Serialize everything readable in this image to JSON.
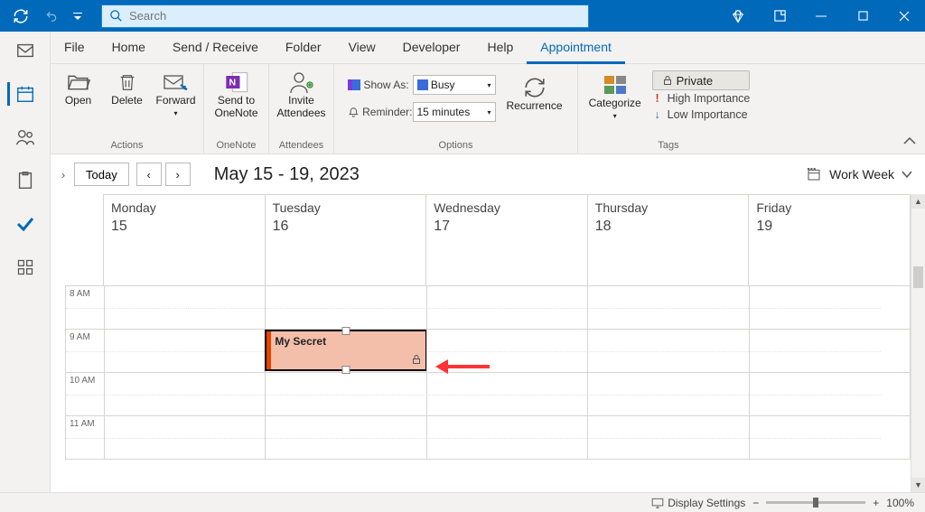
{
  "titlebar": {
    "search_placeholder": "Search"
  },
  "tabs": {
    "file": "File",
    "home": "Home",
    "sendreceive": "Send / Receive",
    "folder": "Folder",
    "view": "View",
    "developer": "Developer",
    "help": "Help",
    "appointment": "Appointment"
  },
  "ribbon": {
    "open": "Open",
    "delete": "Delete",
    "forward": "Forward",
    "actions_label": "Actions",
    "sendto": "Send to OneNote",
    "onenote_label": "OneNote",
    "invite": "Invite Attendees",
    "attendees_label": "Attendees",
    "showas": "Show As:",
    "showas_val": "Busy",
    "reminder": "Reminder:",
    "reminder_val": "15 minutes",
    "recurrence": "Recurrence",
    "options_label": "Options",
    "categorize": "Categorize",
    "private": "Private",
    "high": "High Importance",
    "low": "Low Importance",
    "tags_label": "Tags"
  },
  "calheader": {
    "today": "Today",
    "range": "May 15 - 19, 2023",
    "viewmode": "Work Week"
  },
  "days": [
    {
      "name": "Monday",
      "num": "15"
    },
    {
      "name": "Tuesday",
      "num": "16"
    },
    {
      "name": "Wednesday",
      "num": "17"
    },
    {
      "name": "Thursday",
      "num": "18"
    },
    {
      "name": "Friday",
      "num": "19"
    }
  ],
  "hours": [
    "8 AM",
    "9 AM",
    "10 AM",
    "11 AM"
  ],
  "event": {
    "title": "My Secret"
  },
  "status": {
    "display": "Display Settings",
    "zoom": "100%"
  }
}
